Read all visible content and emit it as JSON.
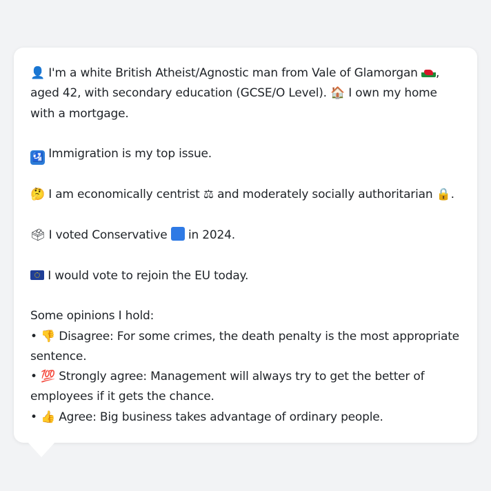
{
  "profile": {
    "intro": {
      "person_icon": "person-silhouette-icon",
      "text_1": "I'm a white British Atheist/Agnostic man from Vale of Glamorgan",
      "flag": "wales-flag-icon",
      "text_2": ", aged 42, with secondary education (GCSE/O Level).",
      "house_icon": "house-icon",
      "text_3": "I own my home with a mortgage."
    },
    "top_issue": {
      "icon": "passport-control-icon",
      "text": "Immigration is my top issue."
    },
    "ideology": {
      "icon": "thinking-face-icon",
      "text_1": "I am economically centrist",
      "scales_icon": "balance-scale-icon",
      "text_2": "and moderately socially authoritarian",
      "lock_icon": "lock-icon",
      "text_3": "."
    },
    "vote": {
      "icon": "ballot-box-icon",
      "text_1": "I voted Conservative",
      "square_icon": "blue-square-icon",
      "text_2": "in 2024."
    },
    "eu": {
      "icon": "eu-flag-icon",
      "text": "I would vote to rejoin the EU today."
    },
    "opinions_heading": "Some opinions I hold:",
    "opinions": [
      {
        "bullet": "•",
        "icon": "thumbs-down-icon",
        "glyph": "👎",
        "text": "Disagree: For some crimes, the death penalty is the most appropriate sentence."
      },
      {
        "bullet": "•",
        "icon": "hundred-points-icon",
        "glyph": "💯",
        "text": "Strongly agree: Management will always try to get the better of employees if it gets the chance."
      },
      {
        "bullet": "•",
        "icon": "thumbs-up-icon",
        "glyph": "👍",
        "text": "Agree: Big business takes advantage of ordinary people."
      }
    ]
  },
  "colors": {
    "background": "#f2f3f5",
    "bubble": "#ffffff",
    "text": "#1f2328"
  }
}
